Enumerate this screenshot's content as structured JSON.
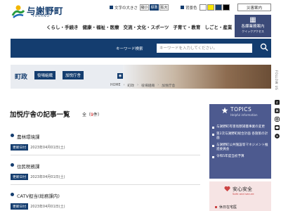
{
  "header": {
    "logo_text": "与謝野町",
    "logo_sub": "YOSANO",
    "font_size_label": "文字の大きさ",
    "font_size_options": [
      "縮小",
      "標準",
      "拡大"
    ],
    "font_size_selected": "標準",
    "bg_color_label": "背景色",
    "bg_color_swatches": [
      "#ffffff",
      "#f7e400",
      "#143d6f",
      "#000000"
    ],
    "disaster_link": "災害案内",
    "nav": [
      "くらし・手続き",
      "健康・福祉・医療",
      "交流・文化・スポーツ",
      "子育て・教育",
      "しごと・産業",
      "町政"
    ],
    "sub_office": {
      "title": "各課業務案内",
      "subtitle": "クイックアクセス"
    }
  },
  "search": {
    "label": "キーワード検索",
    "placeholder": "キーワードを入力してください。"
  },
  "banner": {
    "title": "町政",
    "pills": [
      "役場組織",
      "加悦庁舎"
    ]
  },
  "breadcrumb": [
    "HOME",
    "町政",
    "役場組織",
    "加悦庁舎"
  ],
  "main": {
    "title": "加悦庁舎の記事一覧",
    "count_prefix": "全（",
    "count_num": "9",
    "count_suffix": "件）",
    "date_label": "更新日付",
    "articles": [
      {
        "title": "農林環境課",
        "date": "2023年04月01日(土)"
      },
      {
        "title": "住民税務課",
        "date": "2023年04月01日(土)"
      },
      {
        "title": "CATV担当(総務課内)",
        "date": "2023年04月01日(土)"
      }
    ]
  },
  "topics": {
    "title": "TOPICS",
    "subtitle": "Helpful information",
    "items": [
      "与謝野町有害鳥獣捕獲事業の変更",
      "第2次与謝野町総合計画 各施策の計画",
      "与謝野町公共施設等マネジメント推進委員会",
      "令和5年度当初予算"
    ]
  },
  "safety": {
    "title": "安心安全",
    "subtitle": "Safe and secure",
    "item": "休日在宅医"
  },
  "follow_label": "FOLLOW US",
  "colors": {
    "navy": "#143d6f",
    "topics_bg": "#4d5a8f",
    "safety_bg": "#f6e4e4"
  }
}
